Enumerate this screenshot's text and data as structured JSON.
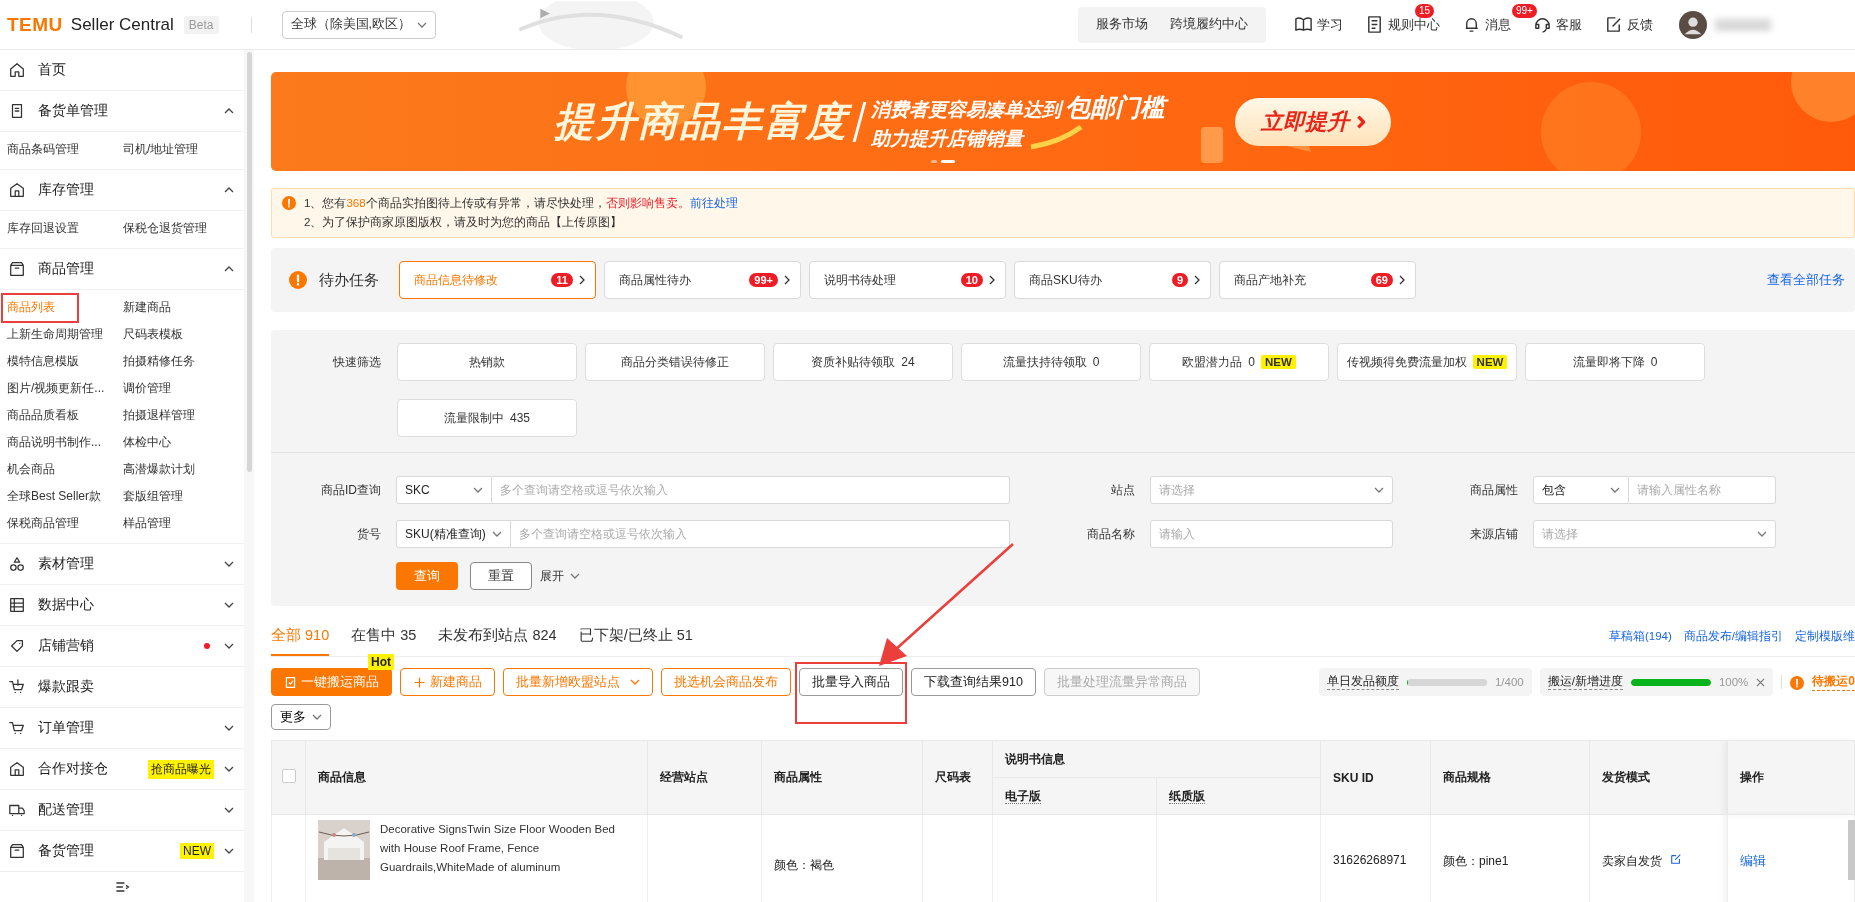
{
  "header": {
    "logo": "TEMU",
    "product": "Seller Central",
    "tag": "Beta",
    "region": "全球（除美国,欧区）",
    "service_links": [
      "服务市场",
      "跨境履约中心"
    ],
    "tools": [
      {
        "label": "学习"
      },
      {
        "label": "规则中心",
        "badge": "15"
      },
      {
        "label": "消息",
        "badge": "99+"
      },
      {
        "label": "客服"
      },
      {
        "label": "反馈"
      }
    ]
  },
  "sidebar": {
    "items": [
      {
        "label": "首页",
        "dot": false
      },
      {
        "label": "备货单管理",
        "expanded": true,
        "dot": false,
        "children": [
          {
            "label": "商品条码管理",
            "selected": false,
            "highlighted": false
          },
          {
            "label": "司机/地址管理",
            "selected": false,
            "highlighted": false
          }
        ]
      },
      {
        "label": "库存管理",
        "expanded": true,
        "dot": false,
        "children": [
          {
            "label": "库存回退设置",
            "selected": false,
            "highlighted": false
          },
          {
            "label": "保税仓退货管理",
            "selected": false,
            "highlighted": false
          }
        ]
      },
      {
        "label": "商品管理",
        "expanded": true,
        "dot": false,
        "children": [
          {
            "label": "商品列表",
            "selected": true,
            "highlighted": true
          },
          {
            "label": "新建商品",
            "selected": false,
            "highlighted": false
          },
          {
            "label": "上新生命周期管理",
            "selected": false,
            "highlighted": false
          },
          {
            "label": "尺码表模板",
            "selected": false,
            "highlighted": false
          },
          {
            "label": "模特信息模版",
            "selected": false,
            "highlighted": false
          },
          {
            "label": "拍摄精修任务",
            "selected": false,
            "highlighted": false
          },
          {
            "label": "图片/视频更新任...",
            "selected": false,
            "highlighted": false
          },
          {
            "label": "调价管理",
            "selected": false,
            "highlighted": false
          },
          {
            "label": "商品品质看板",
            "selected": false,
            "highlighted": false
          },
          {
            "label": "拍摄退样管理",
            "selected": false,
            "highlighted": false
          },
          {
            "label": "商品说明书制作...",
            "selected": false,
            "highlighted": false
          },
          {
            "label": "体检中心",
            "selected": false,
            "highlighted": false
          },
          {
            "label": "机会商品",
            "selected": false,
            "highlighted": false
          },
          {
            "label": "高潜爆款计划",
            "selected": false,
            "highlighted": false
          },
          {
            "label": "全球Best Seller款",
            "selected": false,
            "highlighted": false
          },
          {
            "label": "套版组管理",
            "selected": false,
            "highlighted": false
          },
          {
            "label": "保税商品管理",
            "selected": false,
            "highlighted": false
          },
          {
            "label": "样品管理",
            "selected": false,
            "highlighted": false
          }
        ]
      },
      {
        "label": "素材管理",
        "expanded": false,
        "dot": false
      },
      {
        "label": "数据中心",
        "expanded": false,
        "dot": false
      },
      {
        "label": "店铺营销",
        "expanded": false,
        "dot": true
      },
      {
        "label": "爆款跟卖",
        "dot": false
      },
      {
        "label": "订单管理",
        "expanded": false,
        "dot": false
      },
      {
        "label": "合作对接仓",
        "expanded": false,
        "dot": false,
        "badge": "抢商品曝光"
      },
      {
        "label": "配送管理",
        "expanded": false,
        "dot": false
      },
      {
        "label": "备货管理",
        "expanded": false,
        "dot": false,
        "badge": "NEW"
      }
    ]
  },
  "banner": {
    "title": "提升商品丰富度",
    "line1": "消费者更容易凑单达到",
    "line1_emphasis": "包邮门槛",
    "line2": "助力提升店铺销量",
    "button": "立即提升",
    "dots": [
      {
        "selected": false
      },
      {
        "selected": true
      }
    ]
  },
  "notice": {
    "lines": [
      [
        {
          "kind": "text",
          "text": "1、您有"
        },
        {
          "kind": "count",
          "text": "368"
        },
        {
          "kind": "text",
          "text": "个商品实拍图待上传或有异常，请尽快处理，"
        },
        {
          "kind": "warning",
          "text": "否则影响售卖。"
        },
        {
          "kind": "link",
          "text": "前往处理"
        }
      ],
      [
        {
          "kind": "text",
          "text": "2、为了保护商家原图版权，请及时为您的商品【上传原图】"
        }
      ]
    ]
  },
  "todo": {
    "title": "待办任务",
    "tasks": [
      {
        "label": "商品信息待修改",
        "count": "11",
        "selected": true
      },
      {
        "label": "商品属性待办",
        "count": "99+",
        "selected": false
      },
      {
        "label": "说明书待处理",
        "count": "10",
        "selected": false
      },
      {
        "label": "商品SKU待办",
        "count": "9",
        "selected": false
      },
      {
        "label": "商品产地补充",
        "count": "69",
        "selected": false
      }
    ],
    "view_all": "查看全部任务"
  },
  "filters": {
    "quick_label": "快速筛选",
    "quick": [
      {
        "label": "热销款"
      },
      {
        "label": "商品分类错误待修正"
      },
      {
        "label": "资质补贴待领取",
        "count": "24"
      },
      {
        "label": "流量扶持待领取",
        "count": "0"
      },
      {
        "label": "欧盟潜力品",
        "count": "0",
        "badge": "NEW"
      },
      {
        "label": "传视频得免费流量加权",
        "badge": "NEW"
      },
      {
        "label": "流量即将下降",
        "count": "0"
      },
      {
        "label": "流量限制中",
        "count": "435"
      }
    ],
    "fields": [
      {
        "label": "商品ID查询",
        "kind": "combo",
        "select": "SKC",
        "placeholder": "多个查询请空格或逗号依次输入"
      },
      {
        "label": "站点",
        "kind": "select",
        "placeholder": "请选择"
      },
      {
        "label": "商品属性",
        "kind": "combo",
        "select": "包含",
        "placeholder": "请输入属性名称"
      },
      {
        "label": "货号",
        "kind": "combo",
        "select": "SKU(精准查询)",
        "placeholder": "多个查询请空格或逗号依次输入"
      },
      {
        "label": "商品名称",
        "kind": "input",
        "placeholder": "请输入"
      },
      {
        "label": "来源店铺",
        "kind": "select",
        "placeholder": "请选择"
      }
    ],
    "search": "查询",
    "reset": "重置",
    "expand": "展开"
  },
  "tabs": [
    {
      "label": "全部 910",
      "selected": true
    },
    {
      "label": "在售中 35",
      "selected": false
    },
    {
      "label": "未发布到站点 824",
      "selected": false
    },
    {
      "label": "已下架/已终止 51",
      "selected": false
    }
  ],
  "links": [
    "草稿箱(194)",
    "商品发布/编辑指引",
    "定制模版维"
  ],
  "toolbar": {
    "buttons": [
      {
        "label": "一键搬运商品",
        "kind": "primary",
        "badge": "Hot",
        "disabled": false,
        "highlighted": false
      },
      {
        "label": "新建商品",
        "kind": "add",
        "disabled": false,
        "highlighted": false
      },
      {
        "label": "批量新增欧盟站点",
        "kind": "menu",
        "disabled": false,
        "highlighted": false
      },
      {
        "label": "挑选机会商品发布",
        "kind": "outline",
        "disabled": false,
        "highlighted": false
      },
      {
        "label": "批量导入商品",
        "kind": "plain",
        "disabled": false,
        "highlighted": true
      },
      {
        "label": "下载查询结果910",
        "kind": "plain",
        "disabled": false,
        "highlighted": false
      },
      {
        "label": "批量处理流量异常商品",
        "kind": "plain",
        "disabled": true,
        "highlighted": false
      }
    ],
    "meters": [
      {
        "label": "单日发品额度",
        "level": 0.0025,
        "reading": "1/400",
        "closable": false
      },
      {
        "label": "搬运/新增进度",
        "level": 1,
        "reading": "100%",
        "closable": true
      }
    ],
    "warning": "待搬运0",
    "more": "更多"
  },
  "table": {
    "select_all": {
      "checked": false
    },
    "columns": [
      {
        "label": "商品信息"
      },
      {
        "label": "经营站点"
      },
      {
        "label": "商品属性"
      },
      {
        "label": "尺码表"
      },
      {
        "label": "说明书信息",
        "children": [
          {
            "label": "电子版"
          },
          {
            "label": "纸质版"
          }
        ]
      },
      {
        "label": "SKU ID"
      },
      {
        "label": "商品规格"
      },
      {
        "label": "发货模式"
      },
      {
        "label": "操作"
      }
    ],
    "rows": [
      {
        "title": "Decorative SignsTwin Size Floor Wooden Bed with House Roof Frame, Fence Guardrails,WhiteMade of aluminum",
        "attribute": "颜色：褐色",
        "sku_id": "31626268971",
        "spec": "颜色：pine1",
        "shipping": "卖家自发货",
        "action": "编辑"
      }
    ]
  },
  "annotation": {
    "arrow": true
  }
}
